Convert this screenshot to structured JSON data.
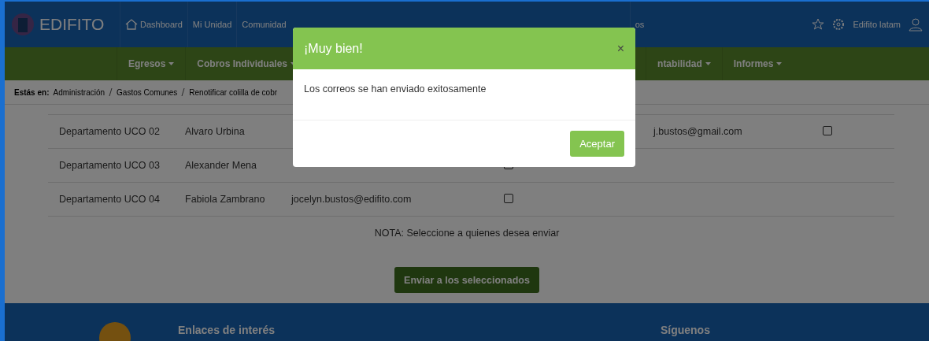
{
  "brand": "EDIFITO",
  "nav": [
    {
      "label": "Dashboard"
    },
    {
      "label": "Mi Unidad"
    },
    {
      "label": "Comunidad"
    },
    {
      "label": "os"
    }
  ],
  "user": {
    "name": "Edifito latam"
  },
  "subnav": [
    {
      "label": "Egresos"
    },
    {
      "label": "Cobros Individuales"
    },
    {
      "label": "ntabilidad"
    },
    {
      "label": "Informes"
    }
  ],
  "breadcrumb": {
    "prefix": "Estás en:",
    "items": [
      "Administración",
      "Gastos Comunes",
      "Renotificar colilla de cobr"
    ]
  },
  "rows": [
    {
      "unit": "Departamento UCO 02",
      "name": "Alvaro Urbina",
      "email": "",
      "email_2": "j.bustos@gmail.com",
      "checked": false
    },
    {
      "unit": "Departamento UCO 03",
      "name": "Alexander Mena",
      "email": "",
      "email_2": "",
      "checked": false
    },
    {
      "unit": "Departamento UCO 04",
      "name": "Fabiola Zambrano",
      "email": "jocelyn.bustos@edifito.com",
      "email_2": "",
      "checked": false
    }
  ],
  "note": "NOTA: Seleccione a quienes desea enviar",
  "send_button": "Enviar a los seleccionados",
  "footer": {
    "links_title": "Enlaces de interés",
    "social_title": "Síguenos"
  },
  "modal": {
    "title": "¡Muy bien!",
    "close": "×",
    "message": "Los correos se han enviado exitosamente",
    "button": "Aceptar"
  }
}
